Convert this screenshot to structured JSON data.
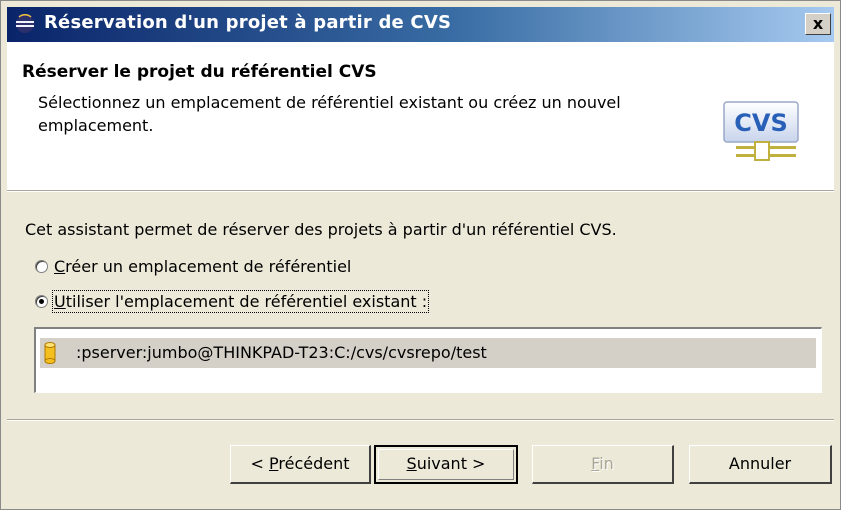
{
  "window": {
    "title": "Réservation d'un projet à partir de CVS",
    "close_label": "x",
    "title_icon": "eclipse-icon"
  },
  "header": {
    "title": "Réserver le projet du référentiel CVS",
    "description": "Sélectionnez un emplacement de référentiel existant ou créez un nouvel emplacement.",
    "logo_text": "CVS",
    "logo_color": "#2860b8"
  },
  "body": {
    "intro": "Cet assistant permet de réserver des projets à partir d'un référentiel CVS.",
    "option_create": {
      "mnemonic": "C",
      "rest": "réer un emplacement de référentiel",
      "checked": false
    },
    "option_use": {
      "mnemonic": "U",
      "rest": "tiliser l'emplacement de référentiel existant :",
      "checked": true
    },
    "repositories": [
      {
        "label": ":pserver:jumbo@THINKPAD-T23:C:/cvs/cvsrepo/test",
        "icon": "repository-icon",
        "selected": true
      }
    ]
  },
  "buttons": {
    "back": {
      "prefix": "< ",
      "mnemonic": "P",
      "rest": "récédent",
      "enabled": true
    },
    "next": {
      "mnemonic": "S",
      "rest": "uivant >",
      "enabled": true,
      "default": true
    },
    "finish": {
      "mnemonic": "F",
      "rest": "in",
      "enabled": false
    },
    "cancel": {
      "label": "Annuler",
      "enabled": true
    }
  }
}
